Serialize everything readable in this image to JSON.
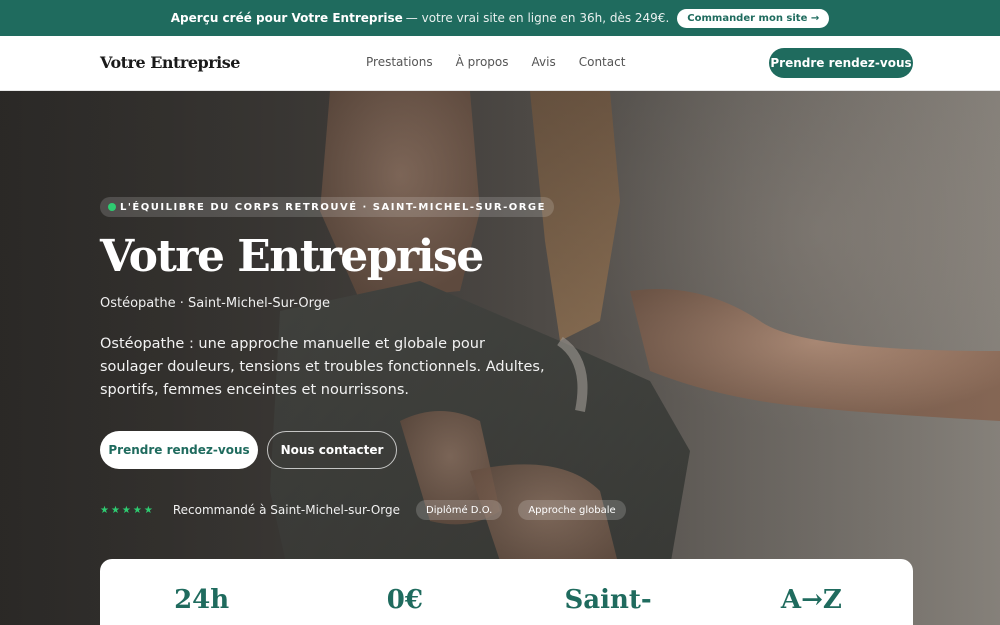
{
  "promo": {
    "strong": "Aperçu créé pour Votre Entreprise",
    "rest": "— votre vrai site en ligne en 36h, dès 249€.",
    "cta": "Commander mon site →"
  },
  "nav": {
    "brand": "Votre Entreprise",
    "links": [
      "Prestations",
      "À propos",
      "Avis",
      "Contact"
    ],
    "cta": "Prendre rendez-vous"
  },
  "hero": {
    "eyebrow": "L'ÉQUILIBRE DU CORPS RETROUVÉ · SAINT-MICHEL-SUR-ORGE",
    "title": "Votre Entreprise",
    "subtitle": "Ostéopathe · Saint-Michel-Sur-Orge",
    "description": "Ostéopathe : une approche manuelle et globale pour soulager douleurs, tensions et troubles fonctionnels. Adultes, sportifs, femmes enceintes et nourrissons.",
    "primary_button": "Prendre rendez-vous",
    "secondary_button": "Nous contacter",
    "stars": "★★★★★",
    "recommendation": "Recommandé à Saint-Michel-sur-Orge",
    "chips": [
      "Diplômé D.O.",
      "Approche globale"
    ]
  },
  "stats": [
    "24h",
    "0€",
    "Saint-",
    "A→Z"
  ],
  "colors": {
    "brand_green": "#1f6b5e",
    "star_green": "#2ecc71"
  }
}
